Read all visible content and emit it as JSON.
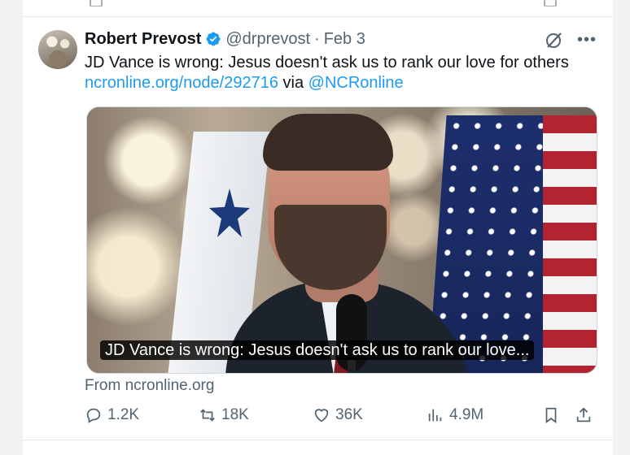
{
  "tweet": {
    "author_name": "Robert Prevost",
    "handle": "@drprevost",
    "separator": "·",
    "date": "Feb 3",
    "text_before_link": "JD Vance is wrong: Jesus doesn't ask us to rank our love for others ",
    "link_text": "ncronline.org/node/292716",
    "text_between": " via ",
    "mention_text": "@NCRonline",
    "media_caption": "JD Vance is wrong: Jesus doesn't ask us to rank our love...",
    "source_label": "From ncronline.org"
  },
  "actions": {
    "replies": "1.2K",
    "reposts": "18K",
    "likes": "36K",
    "views": "4.9M"
  },
  "icons": {
    "verified": "verified-badge-icon",
    "grok": "grok-icon",
    "more": "more-dots-icon",
    "reply": "reply-icon",
    "repost": "repost-icon",
    "like": "heart-icon",
    "views": "views-chart-icon",
    "bookmark": "bookmark-icon",
    "share": "share-icon"
  },
  "colors": {
    "link": "#1d9bf0",
    "secondary_text": "#536471",
    "verified": "#1d9bf0"
  }
}
